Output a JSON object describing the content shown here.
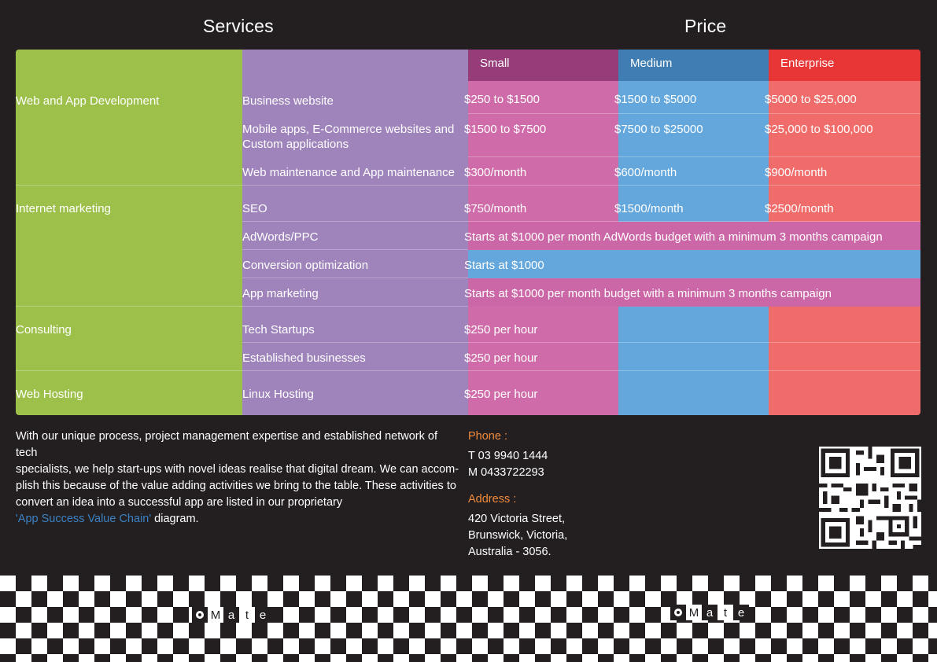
{
  "headers": {
    "services": "Services",
    "price": "Price"
  },
  "tiers": [
    "Small",
    "Medium",
    "Enterprise"
  ],
  "categories": [
    "Web and App Development",
    "Internet marketing",
    "Consulting",
    "Web Hosting"
  ],
  "services": {
    "business_website": {
      "name": "Business website",
      "small": "$250 to $1500",
      "medium": "$1500 to $5000",
      "enterprise": "$5000 to $25,000"
    },
    "mobile_apps": {
      "name_line1": "Mobile apps, E-Commerce websites and",
      "name_line2": "Custom applications",
      "small": "$1500 to $7500",
      "medium": "$7500 to $25000",
      "enterprise": "$25,000 to $100,000"
    },
    "web_maintenance": {
      "name": "Web maintenance and App maintenance",
      "small": "$300/month",
      "medium": "$600/month",
      "enterprise": "$900/month"
    },
    "seo": {
      "name": "SEO",
      "small": "$750/month",
      "medium": "$1500/month",
      "enterprise": "$2500/month"
    },
    "adwords": {
      "name": "AdWords/PPC",
      "price": "Starts at $1000 per month AdWords budget with a minimum 3 months campaign"
    },
    "conversion": {
      "name": "Conversion optimization",
      "price": "Starts at $1000"
    },
    "app_marketing": {
      "name": "App marketing",
      "price": "Starts at $1000 per month budget with a minimum 3 months campaign"
    },
    "tech_startups": {
      "name": "Tech Startups",
      "small": "$250 per hour"
    },
    "established": {
      "name": "Established businesses",
      "small": "$250 per hour"
    },
    "linux_hosting": {
      "name": "Linux Hosting",
      "small": "$250 per hour"
    }
  },
  "description": {
    "line1": "With our unique process, project management expertise and established network of tech",
    "line2": "specialists, we help start-ups with novel ideas realise that digital dream. We can accom-",
    "line3": "plish this because of the value adding activities we bring to the table. These activities to",
    "line4": "convert an idea into a successful app are listed in our proprietary",
    "link": "'App Success Value Chain'",
    "after_link": " diagram."
  },
  "contact": {
    "phone_label": "Phone :",
    "phone_t": "T 03 9940 1444",
    "phone_m": "M 0433722293",
    "address_label": "Address :",
    "address_1": "420 Victoria Street,",
    "address_2": "Brunswick, Victoria,",
    "address_3": "Australia - 3056."
  },
  "logo": {
    "letters": [
      "M",
      "a",
      "t",
      "e"
    ]
  },
  "colors": {
    "background": "#231f20",
    "category": "#9dc04a",
    "service": "#9f84bc",
    "small": "#cf6ba8",
    "medium": "#63a7dc",
    "enterprise": "#ef6c6a",
    "label_accent": "#f08a3c",
    "link": "#3b82c4"
  }
}
